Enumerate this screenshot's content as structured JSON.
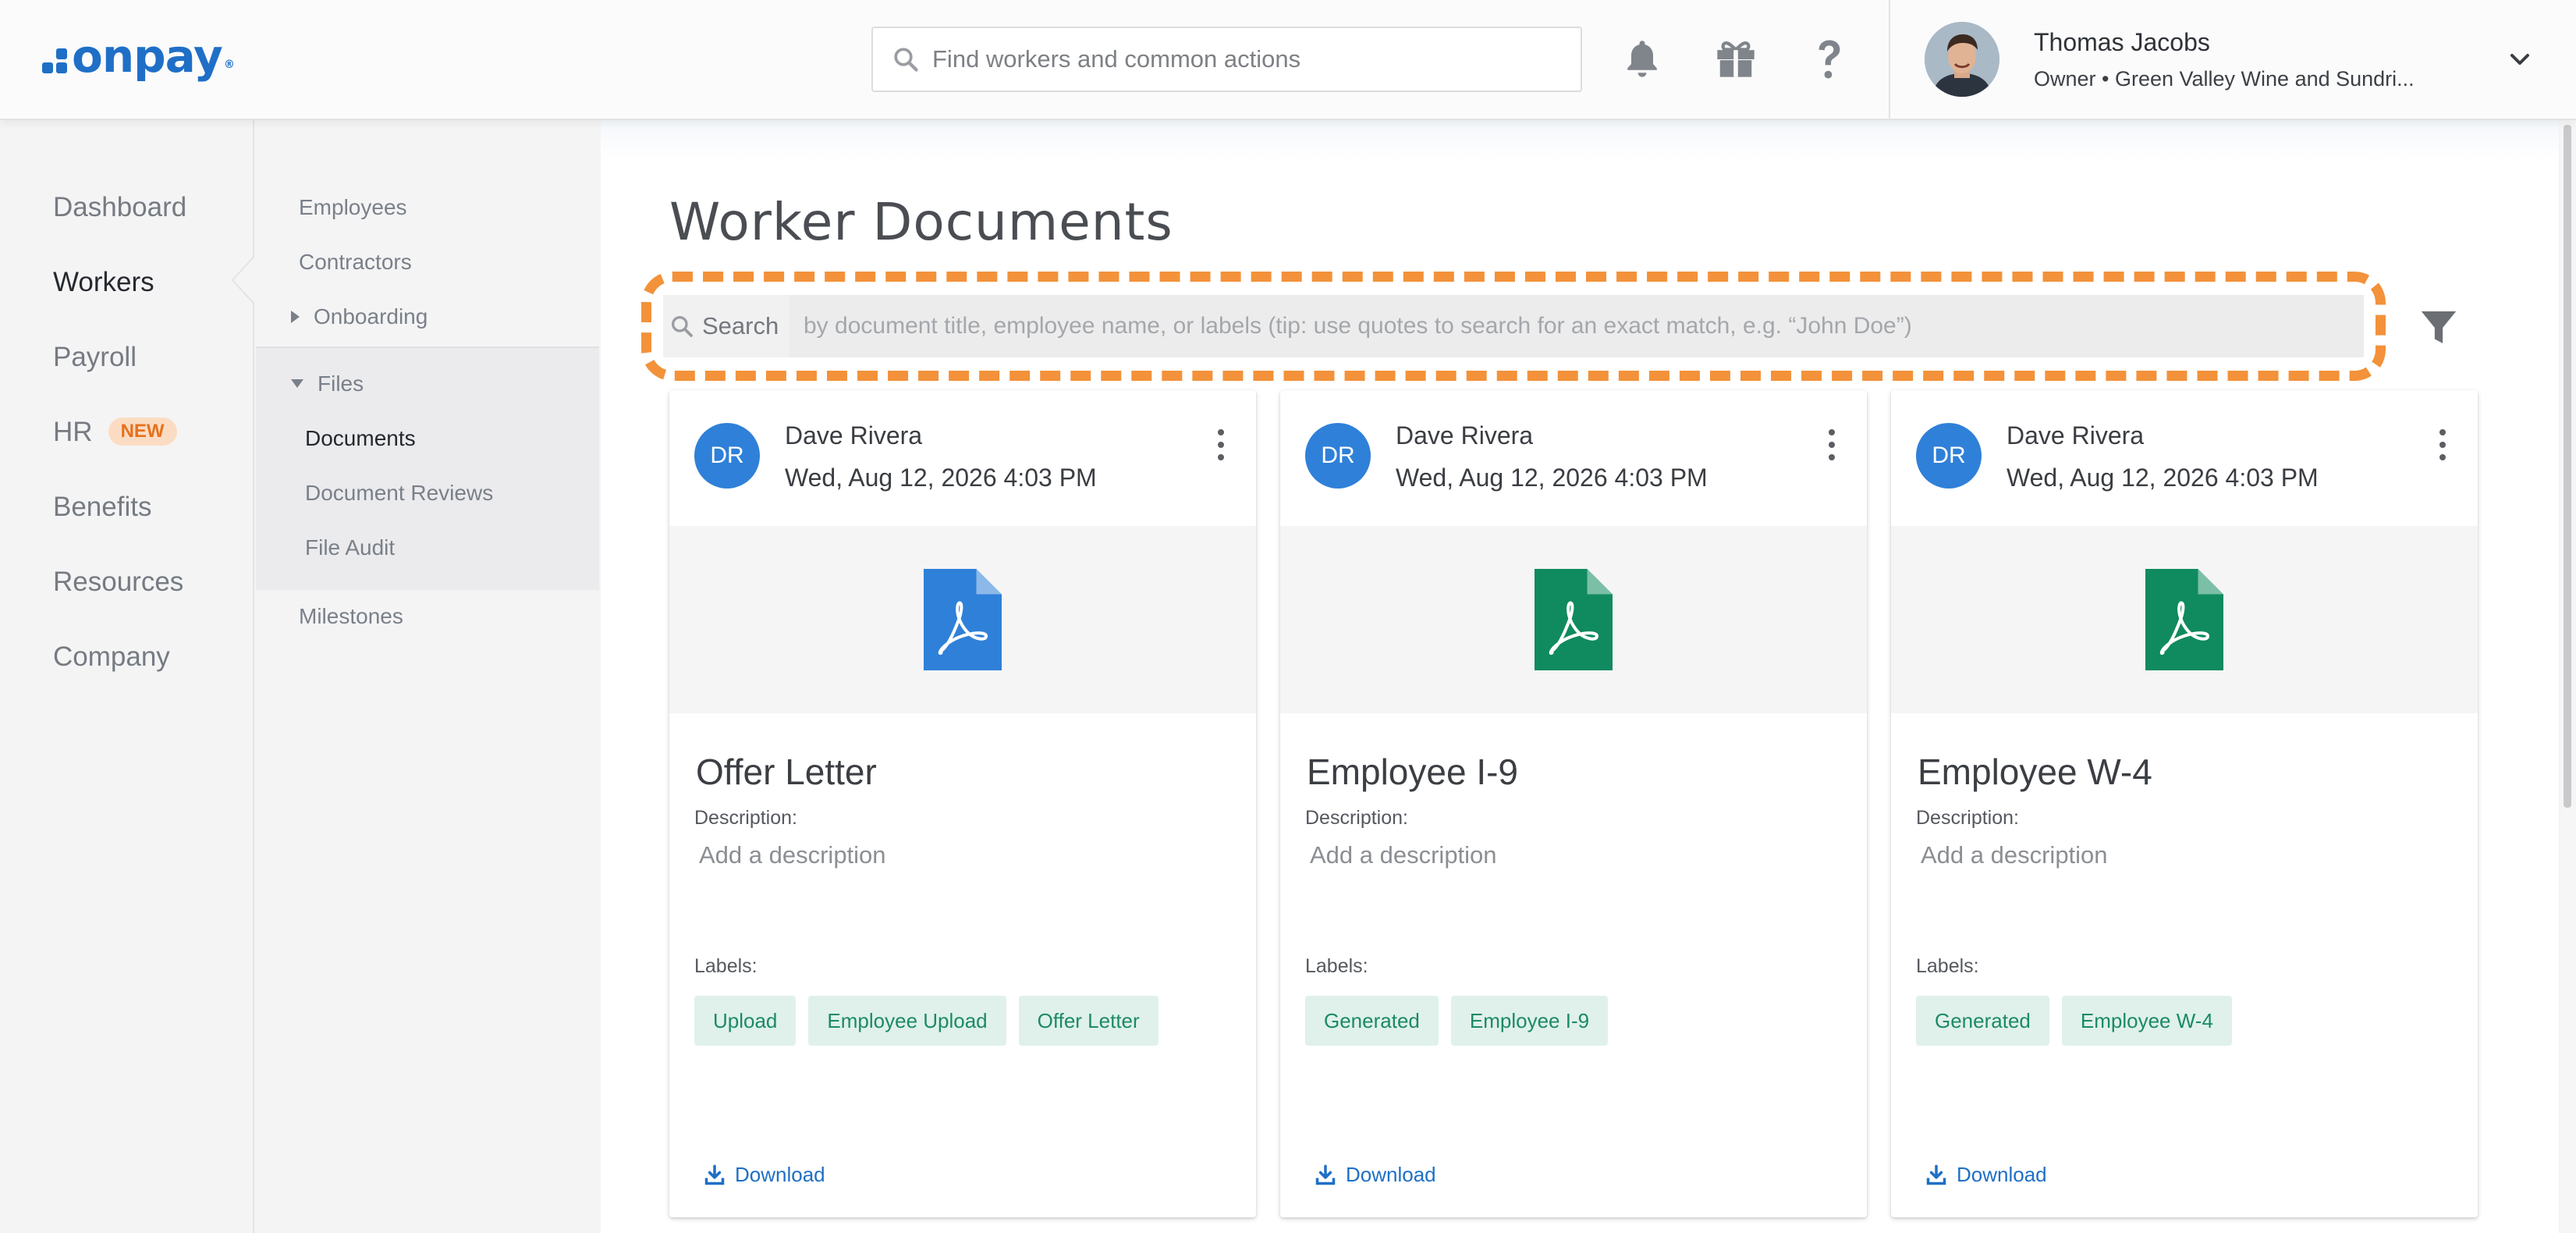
{
  "app": {
    "logo_text": "onpay",
    "logo_mark": "®",
    "search_placeholder": "Find workers and common actions",
    "icons": [
      "bell-icon",
      "gift-icon",
      "help-icon"
    ],
    "user": {
      "name": "Thomas Jacobs",
      "role": "Owner • Green Valley Wine and Sundri..."
    }
  },
  "leftnav": {
    "items": [
      {
        "label": "Dashboard"
      },
      {
        "label": "Workers",
        "active": true
      },
      {
        "label": "Payroll"
      },
      {
        "label": "HR",
        "badge": "NEW"
      },
      {
        "label": "Benefits"
      },
      {
        "label": "Resources"
      },
      {
        "label": "Company"
      }
    ]
  },
  "subnav": {
    "employees": "Employees",
    "contractors": "Contractors",
    "onboarding": "Onboarding",
    "files": "Files",
    "documents": "Documents",
    "document_reviews": "Document Reviews",
    "file_audit": "File Audit",
    "milestones": "Milestones"
  },
  "page": {
    "title": "Worker Documents",
    "search_label": "Search",
    "search_placeholder": "by document title, employee name, or labels (tip: use quotes to search for an exact match, e.g. “John Doe”)"
  },
  "cards": [
    {
      "initials": "DR",
      "author": "Dave Rivera",
      "date": "Wed, Aug 12, 2026 4:03 PM",
      "icon_color": "#2f80d8",
      "title": "Offer Letter",
      "description_label": "Description:",
      "description_placeholder": "Add a description",
      "labels_label": "Labels:",
      "labels": [
        "Upload",
        "Employee Upload",
        "Offer Letter"
      ],
      "download": "Download"
    },
    {
      "initials": "DR",
      "author": "Dave Rivera",
      "date": "Wed, Aug 12, 2026 4:03 PM",
      "icon_color": "#108a5f",
      "title": "Employee I-9",
      "description_label": "Description:",
      "description_placeholder": "Add a description",
      "labels_label": "Labels:",
      "labels": [
        "Generated",
        "Employee I-9"
      ],
      "download": "Download"
    },
    {
      "initials": "DR",
      "author": "Dave Rivera",
      "date": "Wed, Aug 12, 2026 4:03 PM",
      "icon_color": "#108a5f",
      "title": "Employee W-4",
      "description_label": "Description:",
      "description_placeholder": "Add a description",
      "labels_label": "Labels:",
      "labels": [
        "Generated",
        "Employee W-4"
      ],
      "download": "Download"
    }
  ],
  "colors": {
    "brand": "#1f6fc7",
    "highlight": "#f3923a",
    "chip_bg": "#dff1ea",
    "chip_text": "#1c8a64",
    "new_badge": "#e4721e"
  }
}
